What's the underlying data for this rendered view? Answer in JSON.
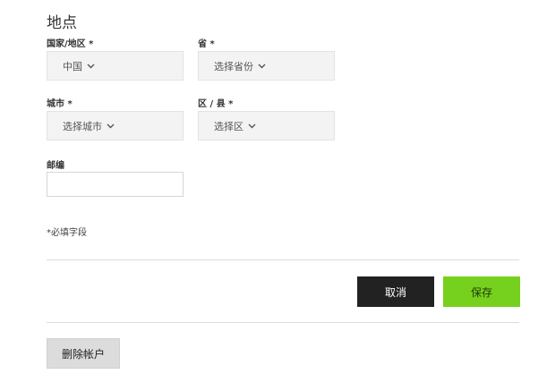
{
  "section": {
    "title": "地点"
  },
  "country": {
    "label": "国家/地区 *",
    "value": "中国"
  },
  "province": {
    "label": "省 *",
    "value": "选择省份"
  },
  "city": {
    "label": "城市 *",
    "value": "选择城市"
  },
  "district": {
    "label": "区 / 县 *",
    "value": "选择区"
  },
  "postal": {
    "label": "邮编",
    "value": ""
  },
  "required_note": "*必填字段",
  "actions": {
    "cancel_label": "取消",
    "save_label": "保存",
    "save_color": "#76d11e",
    "cancel_color": "#222222"
  },
  "account": {
    "delete_label": "删除帐户"
  },
  "icons": {
    "dropdown": "chevron-down-icon"
  }
}
